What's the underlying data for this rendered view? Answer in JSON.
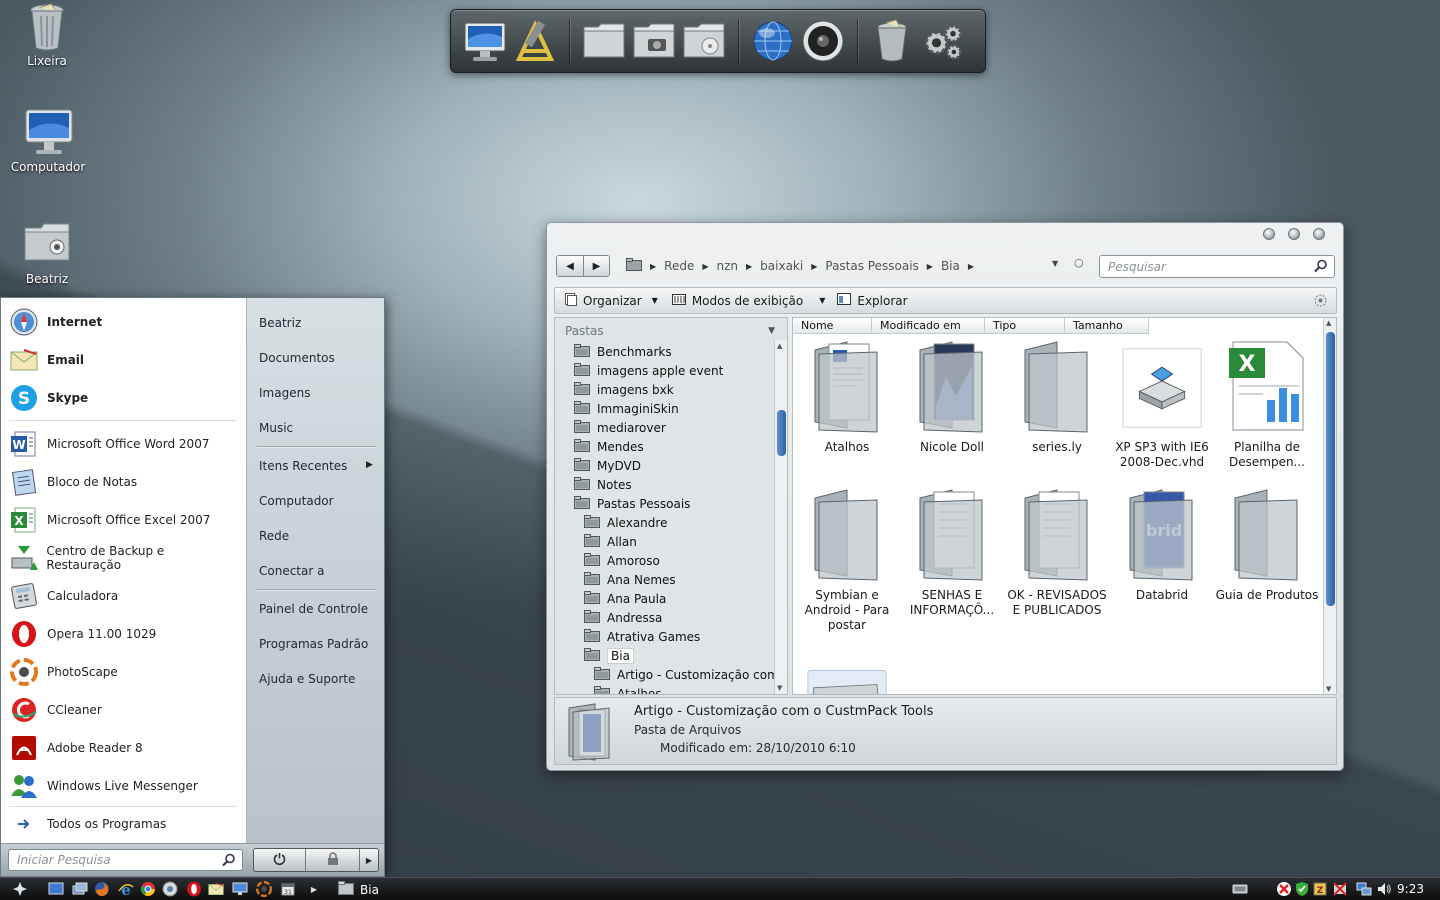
{
  "desktop": {
    "icons": [
      {
        "label": "Lixeira",
        "icon": "trash-icon"
      },
      {
        "label": "Computador",
        "icon": "computer-icon"
      },
      {
        "label": "Beatriz",
        "icon": "user-folder-icon"
      }
    ]
  },
  "dock": {
    "items": [
      "computer-icon",
      "applications-icon",
      "folder-icon",
      "camera-folder-icon",
      "disc-folder-icon",
      "globe-icon",
      "speaker-icon",
      "trash-icon",
      "settings-gears-icon"
    ]
  },
  "start_menu": {
    "pinned": [
      {
        "label": "Internet",
        "icon": "safari-compass-icon"
      },
      {
        "label": "Email",
        "icon": "mail-icon"
      },
      {
        "label": "Skype",
        "icon": "skype-icon"
      }
    ],
    "recent": [
      {
        "label": "Microsoft Office Word 2007",
        "icon": "word-icon"
      },
      {
        "label": "Bloco de Notas",
        "icon": "notepad-icon"
      },
      {
        "label": "Microsoft Office Excel 2007",
        "icon": "excel-icon"
      },
      {
        "label": "Centro de Backup e Restauração",
        "icon": "backup-icon"
      },
      {
        "label": "Calculadora",
        "icon": "calculator-icon"
      },
      {
        "label": "Opera 11.00 1029",
        "icon": "opera-icon"
      },
      {
        "label": "PhotoScape",
        "icon": "photoscape-icon"
      },
      {
        "label": "CCleaner",
        "icon": "ccleaner-icon"
      },
      {
        "label": "Adobe Reader 8",
        "icon": "adobe-reader-icon"
      },
      {
        "label": "Windows Live Messenger",
        "icon": "messenger-icon"
      }
    ],
    "all_programs": "Todos os Programas",
    "search_placeholder": "Iniciar Pesquisa",
    "right": {
      "user": "Beatriz",
      "documents": "Documentos",
      "images": "Imagens",
      "music": "Music",
      "recent_items": "Itens Recentes",
      "computer": "Computador",
      "network": "Rede",
      "connect_to": "Conectar a",
      "control_panel": "Painel de Controle",
      "default_programs": "Programas Padrão",
      "help": "Ajuda e Suporte"
    }
  },
  "explorer": {
    "breadcrumb": [
      "Rede",
      "nzn",
      "baixaki",
      "Pastas Pessoais",
      "Bia"
    ],
    "search_placeholder": "Pesquisar",
    "toolbar": {
      "organize": "Organizar",
      "views": "Modos de exibição",
      "explore": "Explorar"
    },
    "folders_header": "Pastas",
    "tree": [
      {
        "label": "Benchmarks",
        "level": 0
      },
      {
        "label": "imagens apple event",
        "level": 0
      },
      {
        "label": "imagens bxk",
        "level": 0
      },
      {
        "label": "ImmaginiSkin",
        "level": 0
      },
      {
        "label": "mediarover",
        "level": 0
      },
      {
        "label": "Mendes",
        "level": 0
      },
      {
        "label": "MyDVD",
        "level": 0
      },
      {
        "label": "Notes",
        "level": 0
      },
      {
        "label": "Pastas Pessoais",
        "level": 0
      },
      {
        "label": "Alexandre",
        "level": 1
      },
      {
        "label": "Allan",
        "level": 1
      },
      {
        "label": "Amoroso",
        "level": 1
      },
      {
        "label": "Ana Nemes",
        "level": 1
      },
      {
        "label": "Ana Paula",
        "level": 1
      },
      {
        "label": "Andressa",
        "level": 1
      },
      {
        "label": "Atrativa Games",
        "level": 1
      },
      {
        "label": "Bia",
        "level": 1,
        "selected": true
      },
      {
        "label": "Artigo - Customização com o",
        "level": 2
      },
      {
        "label": "Atalhos",
        "level": 2
      }
    ],
    "columns": [
      "Nome",
      "Modificado em",
      "Tipo",
      "Tamanho"
    ],
    "files": [
      {
        "label": "Atalhos",
        "kind": "folder-word"
      },
      {
        "label": "Nicole Doll",
        "kind": "folder-photo"
      },
      {
        "label": "series.ly",
        "kind": "folder"
      },
      {
        "label": "XP SP3 with IE6 2008-Dec.vhd",
        "kind": "vhd"
      },
      {
        "label": "Planilha de Desempen...",
        "kind": "excel"
      },
      {
        "label": "Symbian e Android - Para postar",
        "kind": "folder"
      },
      {
        "label": "SENHAS E INFORMAÇÕ...",
        "kind": "folder-doc"
      },
      {
        "label": "OK - REVISADOS E PUBLICADOS",
        "kind": "folder-doc"
      },
      {
        "label": "Databrid",
        "kind": "folder-blue"
      },
      {
        "label": "Guia de Produtos",
        "kind": "folder"
      },
      {
        "label": "",
        "kind": "folder-open"
      }
    ],
    "details": {
      "title": "Artigo - Customização com o CustmPack Tools",
      "type": "Pasta de Arquivos",
      "modified_label": "Modificado em:",
      "modified_value": "28/10/2010 6:10"
    }
  },
  "taskbar": {
    "quicklaunch": [
      "start-icon",
      "show-desktop-icon",
      "switch-windows-icon",
      "firefox-icon",
      "ie-icon",
      "chrome-icon",
      "itunes-icon",
      "opera-icon",
      "mail-icon",
      "monitor-icon",
      "photoscape-icon",
      "calendar-icon"
    ],
    "task_label": "Bia",
    "tray": [
      "keyboard-icon",
      "antivirus-icon",
      "shield-icon",
      "winzip-icon",
      "network-warning-icon",
      "network-icon",
      "volume-icon"
    ],
    "clock": "9:23"
  }
}
